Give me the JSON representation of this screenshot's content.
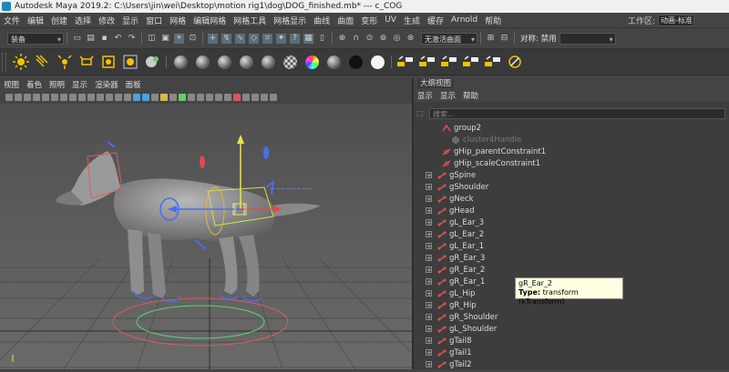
{
  "window": {
    "title": "Autodesk Maya 2019.2: C:\\Users\\jin\\wei\\Desktop\\motion rig1\\dog\\DOG_finished.mb*   ---   c_COG"
  },
  "menubar": {
    "items": [
      "文件",
      "编辑",
      "创建",
      "选择",
      "修改",
      "显示",
      "窗口",
      "网格",
      "编辑网格",
      "网格工具",
      "网格显示",
      "曲线",
      "曲面",
      "变形",
      "UV",
      "生成",
      "缓存",
      "Arnold",
      "帮助"
    ],
    "workspace_label": "工作区:",
    "workspace_value": "动画-标准"
  },
  "toolbar": {
    "mode_value": "装备",
    "live_surface": "无激活曲面",
    "symmetry_label": "对称: 禁用"
  },
  "viewport": {
    "menu": [
      "视图",
      "着色",
      "照明",
      "显示",
      "渲染器",
      "面板"
    ]
  },
  "outliner": {
    "title": "大纲视图",
    "menu": [
      "显示",
      "显示",
      "帮助"
    ],
    "search_placeholder": "搜索...",
    "items": [
      {
        "label": "group2",
        "indent": 1,
        "type": "transform",
        "expand": "",
        "dim": false
      },
      {
        "label": "cluster4Handle",
        "indent": 2,
        "type": "cluster",
        "expand": "",
        "dim": true
      },
      {
        "label": "gHip_parentConstraint1",
        "indent": 1,
        "type": "constraint",
        "expand": "",
        "dim": false
      },
      {
        "label": "gHip_scaleConstraint1",
        "indent": 1,
        "type": "constraint",
        "expand": "",
        "dim": false
      },
      {
        "label": "gSpine",
        "indent": 0,
        "type": "joint",
        "expand": "+",
        "dim": false
      },
      {
        "label": "gShoulder",
        "indent": 0,
        "type": "joint",
        "expand": "+",
        "dim": false
      },
      {
        "label": "gNeck",
        "indent": 0,
        "type": "joint",
        "expand": "+",
        "dim": false
      },
      {
        "label": "gHead",
        "indent": 0,
        "type": "joint",
        "expand": "+",
        "dim": false
      },
      {
        "label": "gL_Ear_3",
        "indent": 0,
        "type": "joint",
        "expand": "+",
        "dim": false
      },
      {
        "label": "gL_Ear_2",
        "indent": 0,
        "type": "joint",
        "expand": "+",
        "dim": false
      },
      {
        "label": "gL_Ear_1",
        "indent": 0,
        "type": "joint",
        "expand": "+",
        "dim": false
      },
      {
        "label": "gR_Ear_3",
        "indent": 0,
        "type": "joint",
        "expand": "+",
        "dim": false
      },
      {
        "label": "gR_Ear_2",
        "indent": 0,
        "type": "joint",
        "expand": "+",
        "dim": false
      },
      {
        "label": "gR_Ear_1",
        "indent": 0,
        "type": "joint",
        "expand": "+",
        "dim": false
      },
      {
        "label": "gL_Hip",
        "indent": 0,
        "type": "joint",
        "expand": "+",
        "dim": false
      },
      {
        "label": "gR_Hip",
        "indent": 0,
        "type": "joint",
        "expand": "+",
        "dim": false
      },
      {
        "label": "gR_Shoulder",
        "indent": 0,
        "type": "joint",
        "expand": "+",
        "dim": false
      },
      {
        "label": "gL_Shoulder",
        "indent": 0,
        "type": "joint",
        "expand": "+",
        "dim": false
      },
      {
        "label": "gTail8",
        "indent": 0,
        "type": "joint",
        "expand": "+",
        "dim": false
      },
      {
        "label": "gTail1",
        "indent": 0,
        "type": "joint",
        "expand": "+",
        "dim": false
      },
      {
        "label": "gTail2",
        "indent": 0,
        "type": "joint",
        "expand": "+",
        "dim": false
      }
    ]
  },
  "tooltip": {
    "name": "gR_Ear_2",
    "type_label": "Type:",
    "type_value": "transform (kTransform)"
  },
  "colors": {
    "joint_icon": "#d9534f",
    "background": "#444444",
    "viewport_bg": "#5b5b5b"
  }
}
